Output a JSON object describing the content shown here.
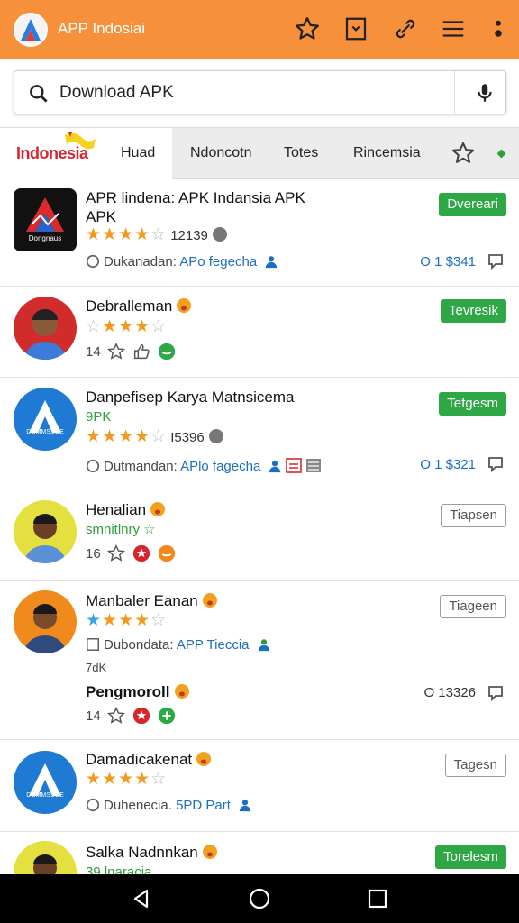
{
  "app": {
    "title": "APP Indosiai",
    "icons": [
      "app-logo",
      "star-icon",
      "bookmark-icon",
      "link-icon",
      "menu-icon",
      "more-vert-icon"
    ]
  },
  "search": {
    "value": "Download APK",
    "icons": [
      "search-icon",
      "mic-icon"
    ]
  },
  "tabs": {
    "brand": "Indonesia",
    "items": [
      "Huad",
      "Ndoncotn",
      "Totes",
      "Rincemsia"
    ],
    "icons": [
      "star-icon",
      "green-dot-icon"
    ]
  },
  "list": [
    {
      "name": "APR lindena: APK Indansia APK",
      "name2": "APK",
      "thumb_text": "Dongnaus",
      "rating": "12139",
      "meta_prefix": "Dukanadan: ",
      "meta_link": "APo fegecha",
      "button": "Dvereari",
      "price": "O 1 $341"
    },
    {
      "name": "Debralleman",
      "reviews": "14",
      "button": "Tevresik"
    },
    {
      "name": "Danpefisep Karya Matnsicema",
      "sub": "9PK",
      "thumb_text": "DOMMSSOE",
      "rating": "I5396",
      "meta_prefix": "Dutmandan: ",
      "meta_link": "APlo fagecha",
      "button": "Tefgesm",
      "price": "O 1 $321"
    },
    {
      "name": "Henalian",
      "sub": "smnitlnry",
      "reviews": "16",
      "button": "Tiapsen"
    },
    {
      "name": "Manbaler Eanan",
      "meta_prefix": "Dubondata: ",
      "meta_link": "APP Tieccia",
      "sub": "7dK",
      "name2": "Pengmoroll",
      "reviews": "14",
      "button": "Tiageen",
      "price": "O 13326"
    },
    {
      "name": "Damadicakenat",
      "thumb_text": "DOMMSSOE",
      "meta_prefix": "Duhenecia. ",
      "meta_link": "5PD Part",
      "button": "Tagesn"
    },
    {
      "name": "Salka Nadnnkan",
      "sub": "39 lnaracia",
      "button": "Torelesm"
    }
  ],
  "colors": {
    "topbar": "#f7903a",
    "accent_green": "#2ea845",
    "link_blue": "#1a6fc0",
    "brand_red": "#d6262d",
    "star": "#f39a1e"
  },
  "navbar": {
    "icons": [
      "back-icon",
      "home-icon",
      "recents-icon"
    ]
  }
}
